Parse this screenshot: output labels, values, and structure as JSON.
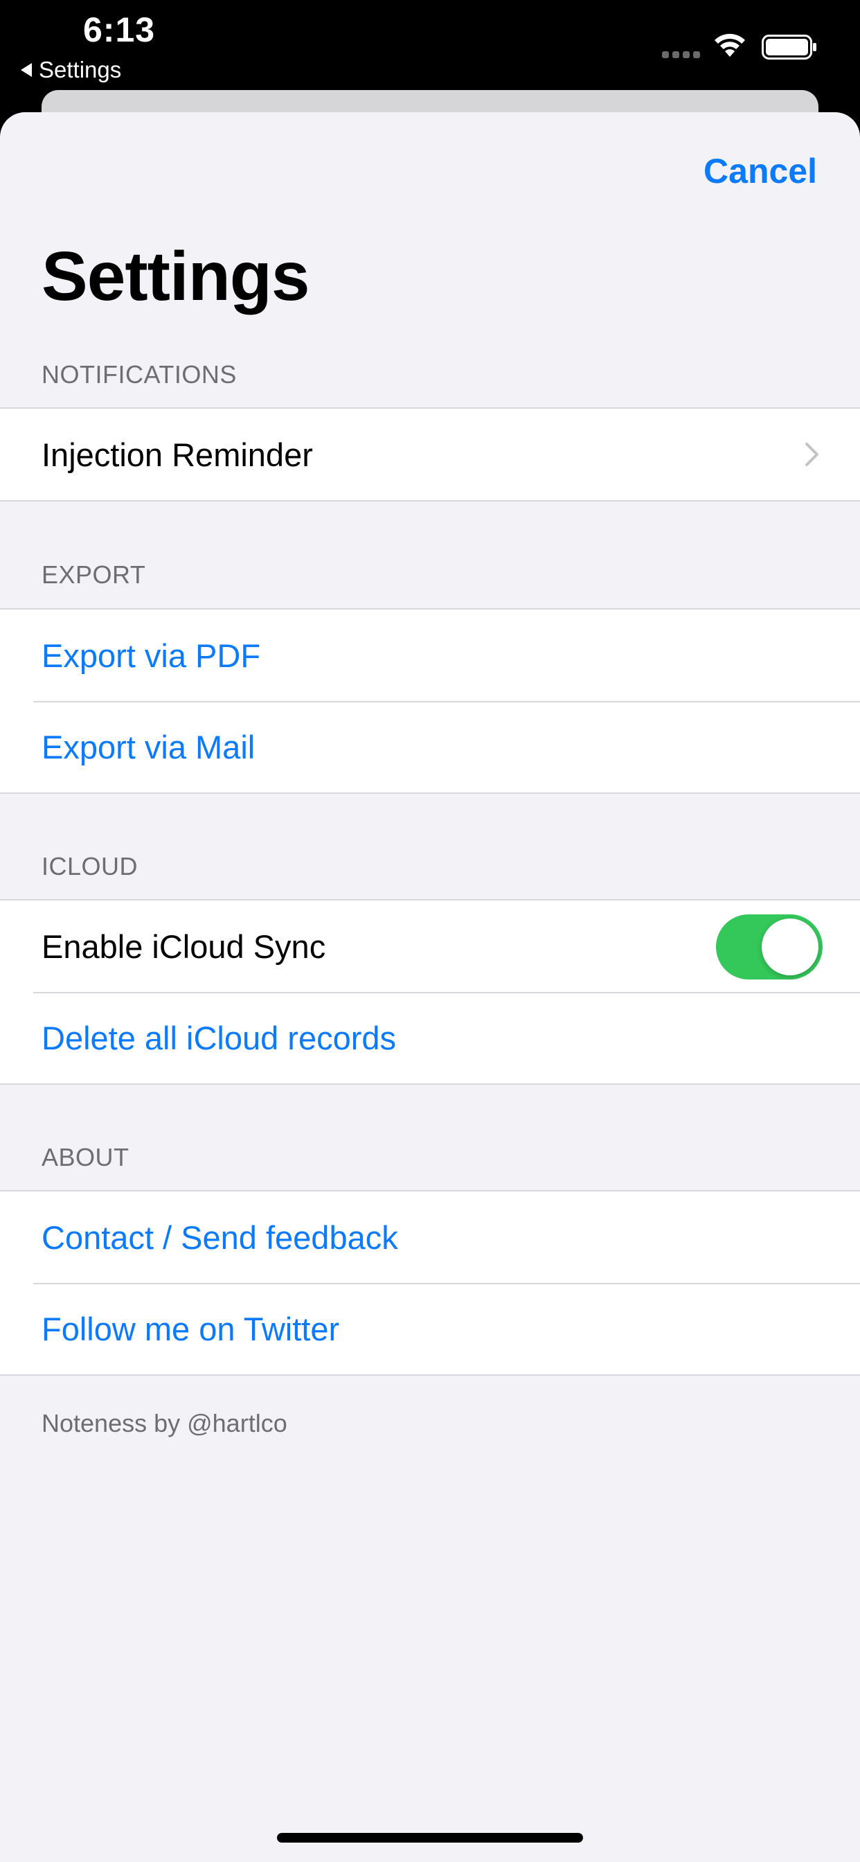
{
  "status_bar": {
    "time": "6:13",
    "back_label": "Settings"
  },
  "header": {
    "cancel_label": "Cancel",
    "title": "Settings"
  },
  "sections": {
    "notifications": {
      "header": "NOTIFICATIONS",
      "rows": [
        {
          "label": "Injection Reminder"
        }
      ]
    },
    "export": {
      "header": "EXPORT",
      "rows": [
        {
          "label": "Export via PDF"
        },
        {
          "label": "Export via Mail"
        }
      ]
    },
    "icloud": {
      "header": "ICLOUD",
      "rows": [
        {
          "label": "Enable iCloud Sync",
          "toggle_on": true
        },
        {
          "label": "Delete all iCloud records"
        }
      ]
    },
    "about": {
      "header": "ABOUT",
      "rows": [
        {
          "label": "Contact / Send feedback"
        },
        {
          "label": "Follow me on Twitter"
        }
      ],
      "footer": "Noteness by @hartlco"
    }
  },
  "colors": {
    "accent": "#0a7aff",
    "toggle_on": "#34c759",
    "background": "#f2f2f7",
    "secondary_text": "#6d6d72"
  },
  "icons": {
    "chevron": "chevron-right-icon",
    "wifi": "wifi-icon",
    "battery": "battery-icon"
  }
}
